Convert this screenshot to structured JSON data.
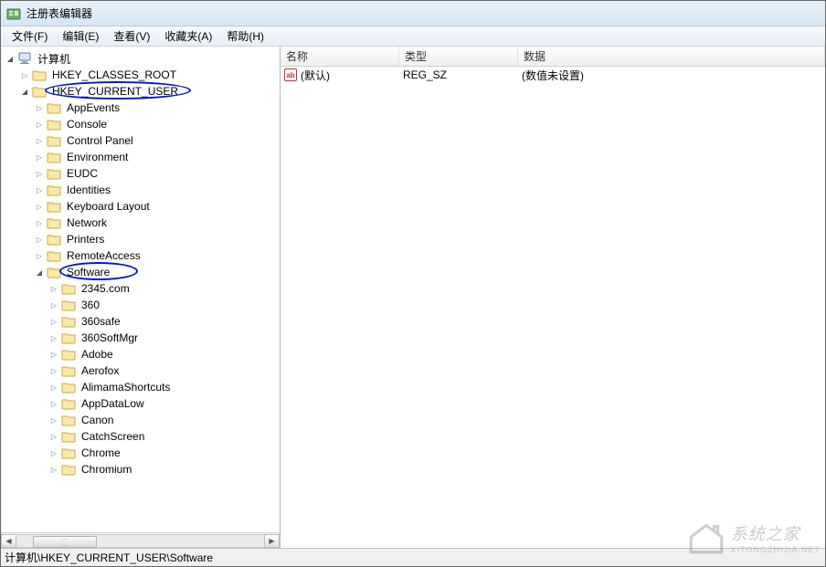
{
  "window": {
    "title": "注册表编辑器"
  },
  "menu": {
    "file": "文件(F)",
    "edit": "编辑(E)",
    "view": "查看(V)",
    "fav": "收藏夹(A)",
    "help": "帮助(H)"
  },
  "list": {
    "columns": {
      "name": "名称",
      "type": "类型",
      "data": "数据"
    },
    "rows": [
      {
        "icon": "ab",
        "name": "(默认)",
        "type": "REG_SZ",
        "data": "(数值未设置)"
      }
    ]
  },
  "tree": {
    "root": "计算机",
    "hives": {
      "hkcr": "HKEY_CLASSES_ROOT",
      "hkcu": "HKEY_CURRENT_USER"
    },
    "hkcu_children": [
      "AppEvents",
      "Console",
      "Control Panel",
      "Environment",
      "EUDC",
      "Identities",
      "Keyboard Layout",
      "Network",
      "Printers",
      "RemoteAccess"
    ],
    "software_label": "Software",
    "software_children": [
      "2345.com",
      "360",
      "360safe",
      "360SoftMgr",
      "Adobe",
      "Aerofox",
      "AlimamaShortcuts",
      "AppDataLow",
      "Canon",
      "CatchScreen",
      "Chrome",
      "Chromium"
    ]
  },
  "status": {
    "path": "计算机\\HKEY_CURRENT_USER\\Software"
  },
  "watermark": {
    "text": "系统之家",
    "sub": "XITONGZHIJIA.NET"
  }
}
